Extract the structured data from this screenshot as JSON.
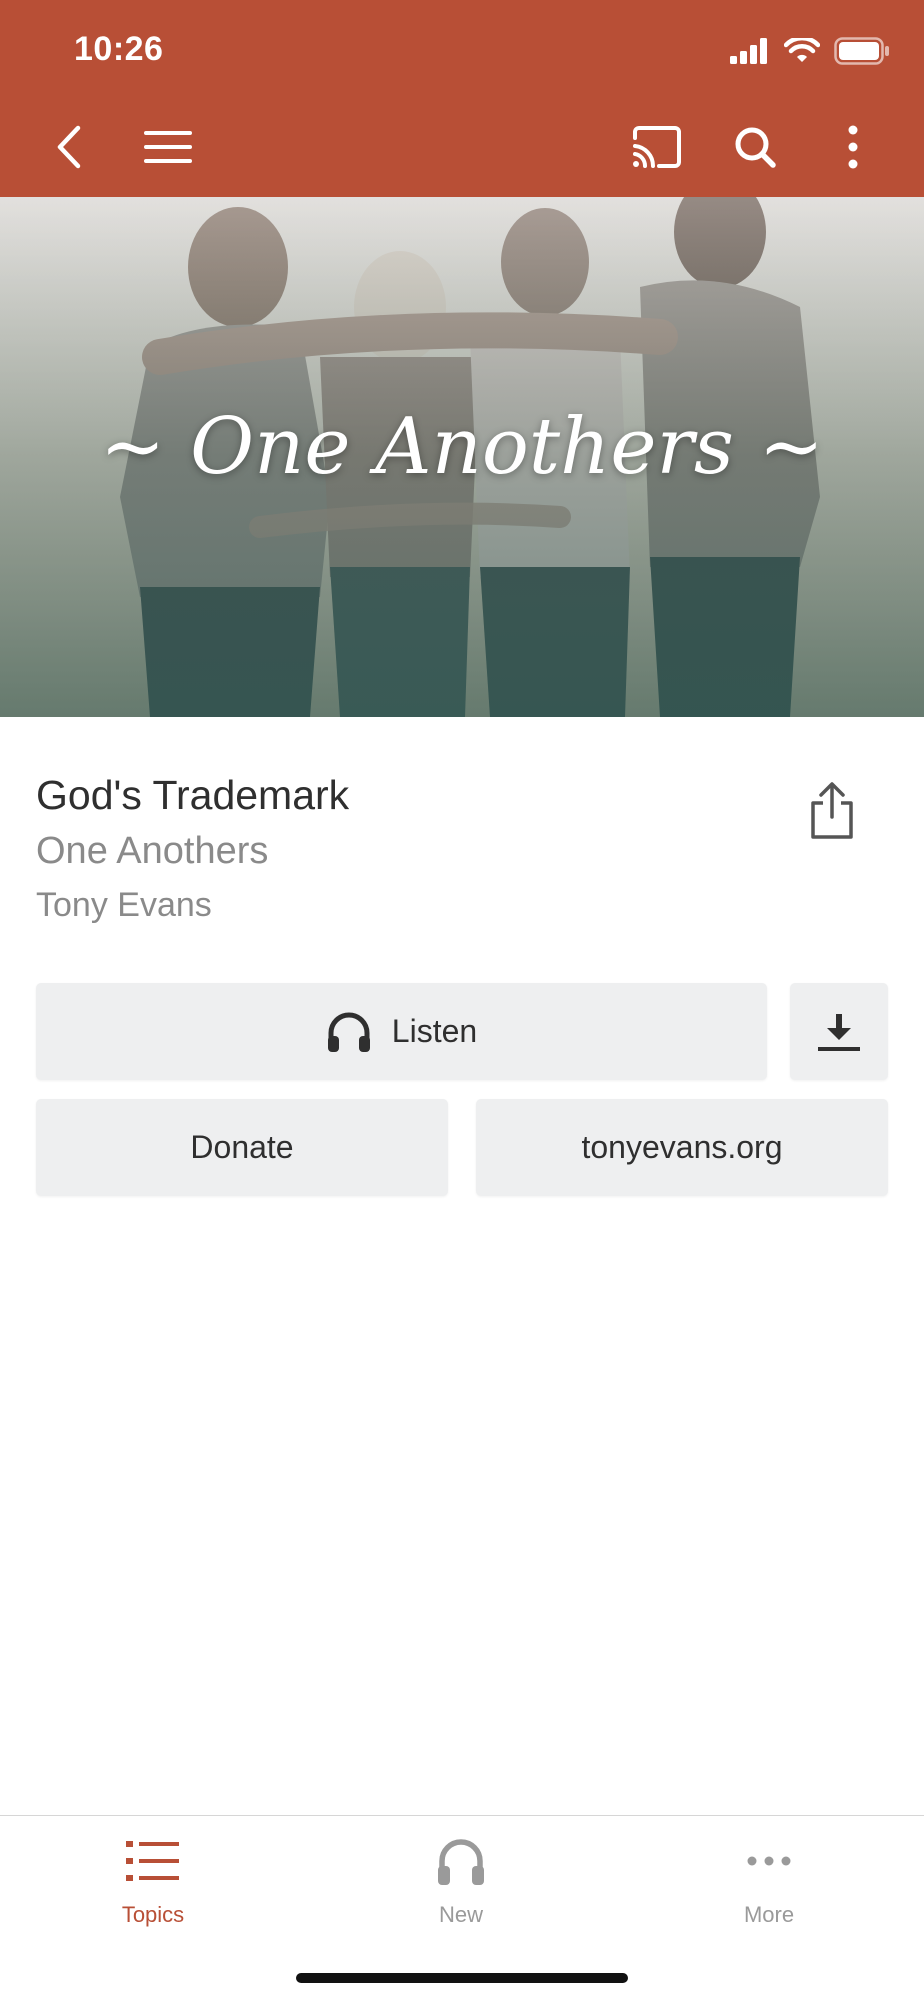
{
  "status_bar": {
    "time": "10:26"
  },
  "toolbar": {
    "back_icon": "chevron-left-icon",
    "menu_icon": "hamburger-icon",
    "cast_icon": "cast-icon",
    "search_icon": "search-icon",
    "more_icon": "vertical-dots-icon"
  },
  "hero": {
    "title": "~ One Anothers ~"
  },
  "message": {
    "title": "God's Trademark",
    "series": "One Anothers",
    "author": "Tony Evans"
  },
  "actions": {
    "listen_label": "Listen",
    "donate_label": "Donate",
    "website_label": "tonyevans.org"
  },
  "tabbar": {
    "tabs": [
      {
        "label": "Topics",
        "icon": "list-icon",
        "active": true
      },
      {
        "label": "New",
        "icon": "headphones-icon",
        "active": false
      },
      {
        "label": "More",
        "icon": "horizontal-dots-icon",
        "active": false
      }
    ]
  },
  "colors": {
    "accent": "#b84f36",
    "button_bg": "#eeeff0",
    "inactive": "#9a9a9a"
  }
}
